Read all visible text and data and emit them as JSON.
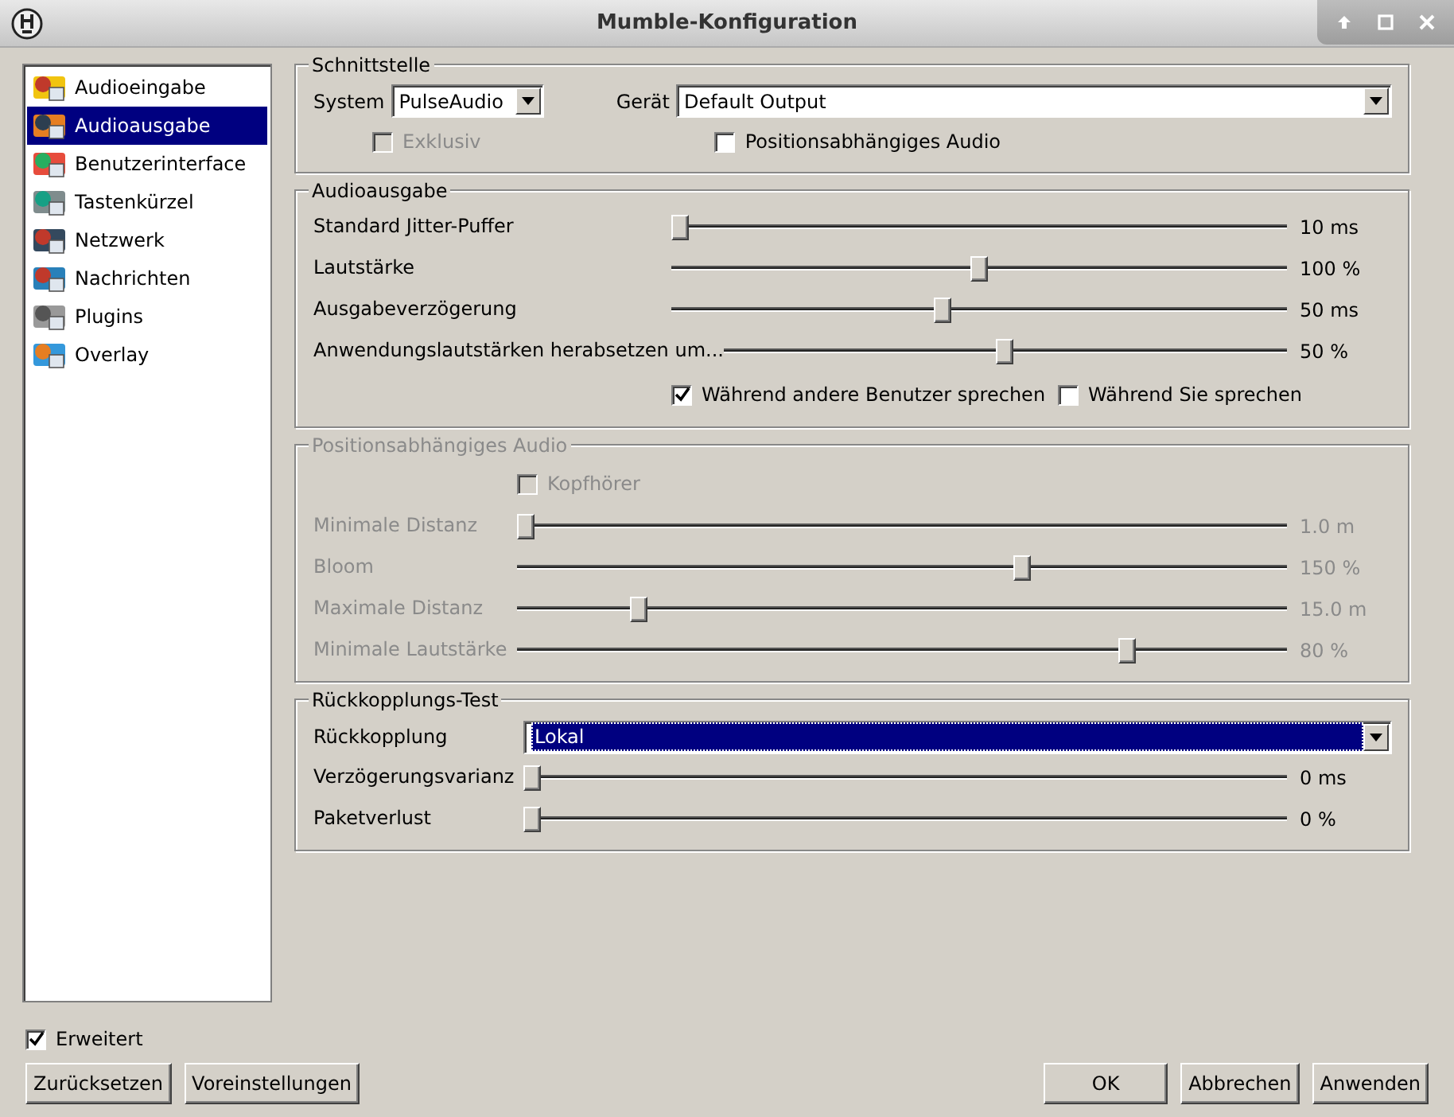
{
  "window": {
    "title": "Mumble-Konfiguration"
  },
  "sidebar": {
    "items": [
      {
        "label": "Audioeingabe",
        "selected": false
      },
      {
        "label": "Audioausgabe",
        "selected": true
      },
      {
        "label": "Benutzerinterface",
        "selected": false
      },
      {
        "label": "Tastenkürzel",
        "selected": false
      },
      {
        "label": "Netzwerk",
        "selected": false
      },
      {
        "label": "Nachrichten",
        "selected": false
      },
      {
        "label": "Plugins",
        "selected": false
      },
      {
        "label": "Overlay",
        "selected": false
      }
    ]
  },
  "groups": [
    {
      "title": "Schnittstelle",
      "disabled": false,
      "kind": "interface",
      "system_label": "System",
      "system_value": "PulseAudio",
      "device_label": "Gerät",
      "device_value": "Default Output",
      "checks": [
        {
          "label": "Exklusiv",
          "checked": false,
          "disabled": true
        },
        {
          "label": "Positionsabhängiges Audio",
          "checked": false,
          "disabled": false
        }
      ]
    },
    {
      "title": "Audioausgabe",
      "disabled": false,
      "kind": "sliders",
      "rows": [
        {
          "kind": "slider",
          "label": "Standard Jitter-Puffer",
          "level": 0.0,
          "reading": "10 ms"
        },
        {
          "kind": "slider",
          "label": "Lautstärke",
          "level": 0.5,
          "reading": "100 %"
        },
        {
          "kind": "slider",
          "label": "Ausgabeverzögerung",
          "level": 0.44,
          "reading": "50 ms"
        },
        {
          "kind": "slider",
          "label": "Anwendungslautstärken herabsetzen um...",
          "level": 0.5,
          "reading": "50 %"
        },
        {
          "kind": "checks",
          "checks": [
            {
              "label": "Während andere Benutzer sprechen",
              "checked": true
            },
            {
              "label": "Während Sie sprechen",
              "checked": false
            }
          ]
        }
      ]
    },
    {
      "title": "Positionsabhängiges Audio",
      "disabled": true,
      "kind": "sliders",
      "rows": [
        {
          "kind": "checks",
          "checks": [
            {
              "label": "Kopfhörer",
              "checked": false
            }
          ]
        },
        {
          "kind": "slider",
          "label": "Minimale Distanz",
          "level": 0.0,
          "reading": "1.0 m"
        },
        {
          "kind": "slider",
          "label": "Bloom",
          "level": 0.66,
          "reading": "150 %"
        },
        {
          "kind": "slider",
          "label": "Maximale Distanz",
          "level": 0.15,
          "reading": "15.0 m"
        },
        {
          "kind": "slider",
          "label": "Minimale Lautstärke",
          "level": 0.8,
          "reading": "80 %"
        }
      ]
    },
    {
      "title": "Rückkopplungs-Test",
      "disabled": false,
      "kind": "sliders",
      "rows": [
        {
          "kind": "select",
          "label": "Rückkopplung",
          "value": "Lokal"
        },
        {
          "kind": "slider",
          "label": "Verzögerungsvarianz",
          "level": 0.0,
          "reading": "0 ms"
        },
        {
          "kind": "slider",
          "label": "Paketverlust",
          "level": 0.0,
          "reading": "0 %"
        }
      ]
    }
  ],
  "advanced": {
    "label": "Erweitert",
    "checked": true
  },
  "buttons_left": [
    "Zurücksetzen",
    "Voreinstellungen"
  ],
  "buttons_right": [
    "OK",
    "Abbrechen",
    "Anwenden"
  ]
}
